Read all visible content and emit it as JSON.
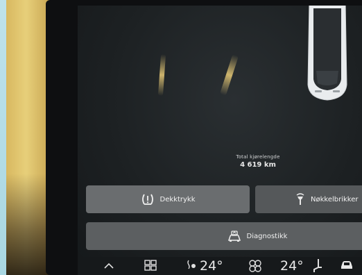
{
  "odometer": {
    "label": "Total kjørelengde",
    "value": "4 619 km"
  },
  "buttons": {
    "tire_pressure": "Dekktrykk",
    "key_fob": "Nøkkelbrikker",
    "diagnostics": "Diagnostikk"
  },
  "climate": {
    "left_temp": "24°",
    "right_temp": "24°"
  },
  "icons": [
    "tire-pressure-icon",
    "key-fob-icon",
    "diagnostics-icon",
    "home-icon",
    "app-grid-icon",
    "seat-heat-icon",
    "fan-icon",
    "seat-icon",
    "car-icon"
  ],
  "colors": {
    "screen_bg": "#1d2123",
    "button_bg": "#6a6d6f",
    "text": "#f2f2f2"
  }
}
